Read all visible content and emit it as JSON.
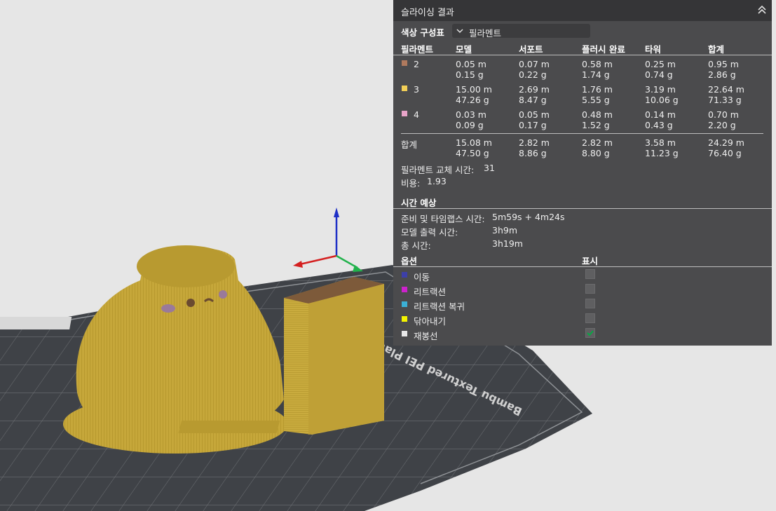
{
  "panel": {
    "title": "슬라이싱 결과",
    "color_scheme_label": "색상 구성표",
    "color_scheme_value": "필라멘트",
    "table": {
      "headers": [
        "필라멘트",
        "모델",
        "서포트",
        "플러시 완료",
        "타워",
        "합계"
      ],
      "rows": [
        {
          "id": "2",
          "color": "#b07a5e",
          "model": [
            "0.05 m",
            "0.15 g"
          ],
          "support": [
            "0.07 m",
            "0.22 g"
          ],
          "flush": [
            "0.58 m",
            "1.74 g"
          ],
          "tower": [
            "0.25 m",
            "0.74 g"
          ],
          "total": [
            "0.95 m",
            "2.86 g"
          ]
        },
        {
          "id": "3",
          "color": "#f2cf57",
          "model": [
            "15.00 m",
            "47.26 g"
          ],
          "support": [
            "2.69 m",
            "8.47 g"
          ],
          "flush": [
            "1.76 m",
            "5.55 g"
          ],
          "tower": [
            "3.19 m",
            "10.06 g"
          ],
          "total": [
            "22.64 m",
            "71.33 g"
          ]
        },
        {
          "id": "4",
          "color": "#e8a4c9",
          "model": [
            "0.03 m",
            "0.09 g"
          ],
          "support": [
            "0.05 m",
            "0.17 g"
          ],
          "flush": [
            "0.48 m",
            "1.52 g"
          ],
          "tower": [
            "0.14 m",
            "0.43 g"
          ],
          "total": [
            "0.70 m",
            "2.20 g"
          ]
        }
      ],
      "total_row": {
        "label": "합계",
        "model": [
          "15.08 m",
          "47.50 g"
        ],
        "support": [
          "2.82 m",
          "8.86 g"
        ],
        "flush": [
          "2.82 m",
          "8.80 g"
        ],
        "tower": [
          "3.58 m",
          "11.23 g"
        ],
        "total": [
          "24.29 m",
          "76.40 g"
        ]
      }
    },
    "filament_change_label": "필라멘트 교체 시간:",
    "filament_change_value": "31",
    "cost_label": "비용:",
    "cost_value": "1.93",
    "time_section": {
      "title": "시간 예상",
      "prep_label": "준비 및 타임랩스 시간:",
      "prep_value": "5m59s + 4m24s",
      "model_label": "모델 출력 시간:",
      "model_value": "3h9m",
      "total_label": "총 시간:",
      "total_value": "3h19m"
    },
    "options": {
      "title": "옵션",
      "show_label": "표시",
      "items": [
        {
          "label": "이동",
          "color": "#3d3fa8",
          "checked": false
        },
        {
          "label": "리트랙션",
          "color": "#cc22cc",
          "checked": false
        },
        {
          "label": "리트랙션 복귀",
          "color": "#3bb0d6",
          "checked": false
        },
        {
          "label": "닦아내기",
          "color": "#f3f300",
          "checked": false
        },
        {
          "label": "재봉선",
          "color": "#e8e8e8",
          "checked": true
        }
      ]
    }
  },
  "scene": {
    "plate_text": "Bambu Textured PEI Plate",
    "axis_colors": {
      "x": "#d42020",
      "y": "#22b24c",
      "z": "#1d2fc6"
    },
    "model_color": "#c9ab3e"
  }
}
